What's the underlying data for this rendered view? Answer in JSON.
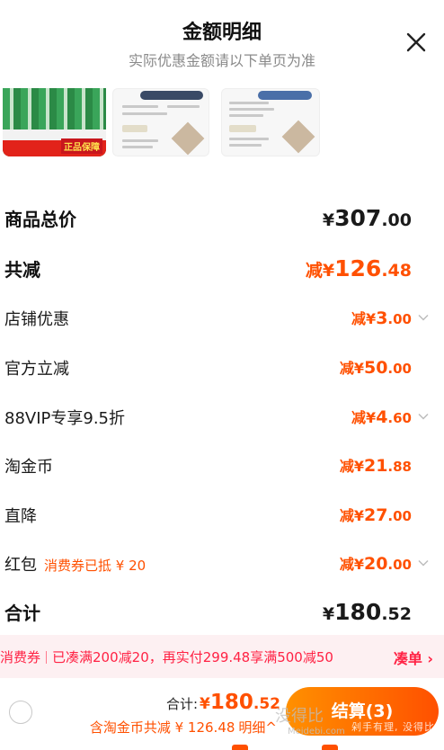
{
  "header": {
    "title": "金额明细",
    "subtitle": "实际优惠金额请以下单页为准"
  },
  "thumbnails": [
    {
      "name": "product-image-1",
      "badge": "正品保障"
    },
    {
      "name": "product-image-2"
    },
    {
      "name": "product-image-3"
    }
  ],
  "summary": {
    "total_price": {
      "label": "商品总价",
      "currency": "¥",
      "int": "307",
      "dec": ".00"
    },
    "total_discount": {
      "label": "共减",
      "prefix": "减¥",
      "int": "126",
      "dec": ".48"
    }
  },
  "discounts": [
    {
      "label": "店铺优惠",
      "prefix": "减¥",
      "int": "3",
      "dec": ".00",
      "expandable": true
    },
    {
      "label": "官方立减",
      "prefix": "减¥",
      "int": "50",
      "dec": ".00",
      "expandable": false
    },
    {
      "label": "88VIP专享9.5折",
      "prefix": "减¥",
      "int": "4",
      "dec": ".60",
      "expandable": true
    },
    {
      "label": "淘金币",
      "prefix": "减¥",
      "int": "21",
      "dec": ".88",
      "expandable": false
    },
    {
      "label": "直降",
      "prefix": "减¥",
      "int": "27",
      "dec": ".00",
      "expandable": false
    },
    {
      "label": "红包",
      "note": "消费券已抵 ¥ 20",
      "prefix": "减¥",
      "int": "20",
      "dec": ".00",
      "expandable": true
    }
  ],
  "subtotal": {
    "label": "合计",
    "currency": "¥",
    "int": "180",
    "dec": ".52"
  },
  "promo_banner": {
    "tag": "消费券",
    "text": "已凑满200减20，再实付299.48享满500减50",
    "link": "凑单 ›"
  },
  "checkout_bar": {
    "total_label": "合计:",
    "total_currency": "¥",
    "total_int": "180",
    "total_dec": ".52",
    "saving_text": "含淘金币共减 ¥ 126.48",
    "detail_label": "明细^",
    "checkout_label": "结算(3)",
    "watermark_brand": "没得比",
    "watermark_url": "Meidebi.com",
    "watermark_slogan": "剁手有理, 没得比"
  },
  "colors": {
    "accent": "#ff5000",
    "promo_bg": "#fdf0f2",
    "promo_text": "#ff2244",
    "checkout_gradient_start": "#ff9000",
    "checkout_gradient_end": "#ff5000"
  },
  "icons": {
    "close": "close-icon",
    "expand": "chevron-down-icon",
    "radio": "radio-unchecked-icon"
  }
}
